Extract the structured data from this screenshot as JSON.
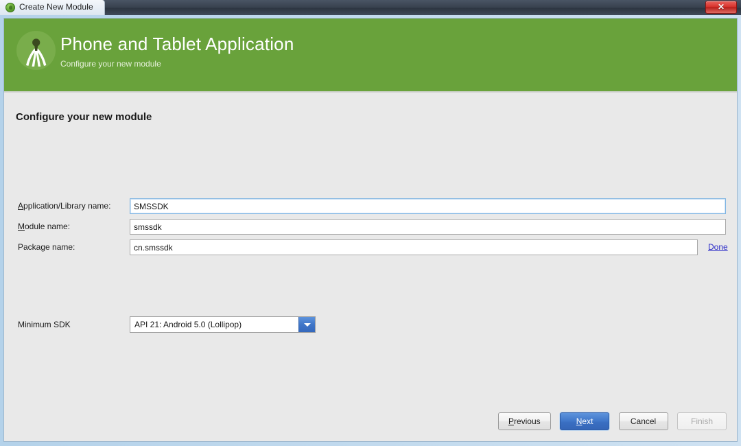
{
  "window": {
    "title": "Create New Module",
    "app_icon": "android-studio-icon",
    "close_label": "✕"
  },
  "wizard": {
    "title": "Phone and Tablet Application",
    "subtitle": "Configure your new module",
    "logo_icon": "android-studio-compass-icon",
    "accent_green": "#69a23b"
  },
  "main": {
    "section_title": "Configure your new module",
    "fields": [
      {
        "label_prefix": "",
        "label_mnemonic": "A",
        "label_suffix": "pplication/Library name:",
        "value": "SMSSDK",
        "placeholder": "Application name",
        "focused": true
      },
      {
        "label_prefix": "",
        "label_mnemonic": "M",
        "label_suffix": "odule name:",
        "value": "smssdk",
        "placeholder": "Module name",
        "focused": false
      },
      {
        "label_prefix": "Package name:",
        "label_mnemonic": "",
        "label_suffix": "",
        "value": "cn.smssdk",
        "placeholder": "Package name",
        "focused": false
      }
    ],
    "done_link": "Done",
    "min_sdk": {
      "label": "Minimum SDK",
      "value": "API 21: Android 5.0 (Lollipop)",
      "arrow_icon": "chevron-down-icon"
    }
  },
  "footer": {
    "previous": {
      "prefix": "",
      "mnemonic": "P",
      "suffix": "revious"
    },
    "next": {
      "prefix": "",
      "mnemonic": "N",
      "suffix": "ext"
    },
    "cancel": {
      "prefix": "Cancel",
      "mnemonic": "",
      "suffix": ""
    },
    "finish": {
      "prefix": "Finish",
      "mnemonic": "",
      "suffix": ""
    }
  }
}
